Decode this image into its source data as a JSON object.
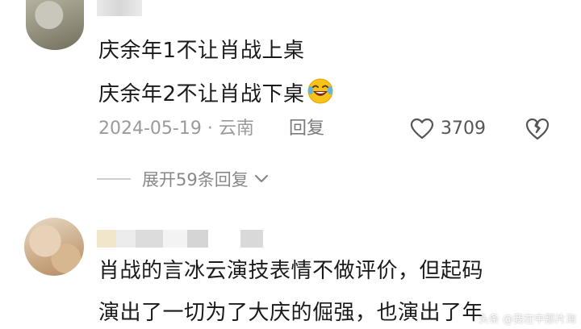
{
  "comments": [
    {
      "lines": [
        "庆余年1不让肖战上桌",
        "庆余年2不让肖战下桌"
      ],
      "emoji": "laughing-emoji",
      "date": "2024-05-19",
      "location": "云南",
      "reply_label": "回复",
      "like_count": "3709",
      "expand_label": "展开59条回复"
    },
    {
      "lines": [
        "肖战的言冰云演技表情不做评价，但起码",
        "演出了一切为了大庆的倔强，也演出了年"
      ]
    }
  ],
  "meta_separator": "·",
  "watermark": "头条 @我在中那片海",
  "colors": {
    "text": "#1a1a1a",
    "meta": "#9a9a9a",
    "emoji": "#f5b800"
  }
}
